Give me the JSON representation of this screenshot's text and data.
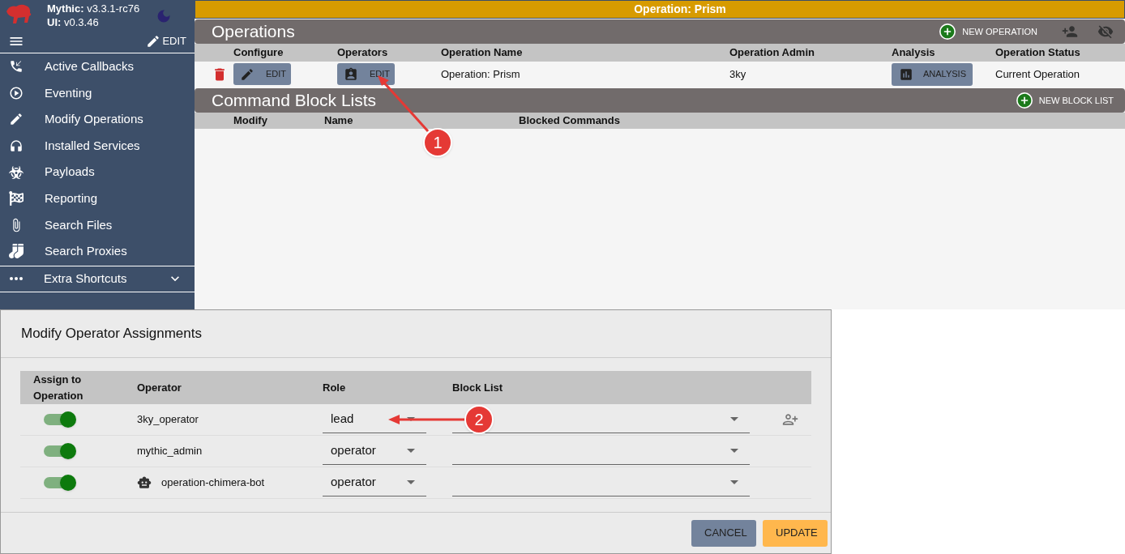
{
  "app": {
    "name_label": "Mythic:",
    "version": "v3.3.1-rc76",
    "ui_label": "UI:",
    "ui_version": "v0.3.46",
    "edit_label": "EDIT"
  },
  "sidebar": {
    "items": [
      {
        "label": "Active Callbacks"
      },
      {
        "label": "Eventing"
      },
      {
        "label": "Modify Operations"
      },
      {
        "label": "Installed Services"
      },
      {
        "label": "Payloads"
      },
      {
        "label": "Reporting"
      },
      {
        "label": "Search Files"
      },
      {
        "label": "Search Proxies"
      }
    ],
    "extra": {
      "label": "Extra Shortcuts",
      "expanded": false
    }
  },
  "banner": "Operation: Prism",
  "operations": {
    "title": "Operations",
    "new_button": "NEW OPERATION",
    "columns": [
      "Configure",
      "Operators",
      "Operation Name",
      "Operation Admin",
      "Analysis",
      "Operation Status"
    ],
    "rows": [
      {
        "configure": "EDIT",
        "operators": "EDIT",
        "name": "Operation: Prism",
        "admin": "3ky",
        "analysis": "ANALYSIS",
        "status": "Current Operation"
      }
    ]
  },
  "block_lists": {
    "title": "Command Block Lists",
    "new_button": "NEW BLOCK LIST",
    "columns": [
      "Modify",
      "Name",
      "Blocked Commands"
    ]
  },
  "dialog": {
    "title": "Modify Operator Assignments",
    "columns": [
      "Assign to Operation",
      "Operator",
      "Role",
      "Block List"
    ],
    "rows": [
      {
        "assigned": true,
        "kind": "human",
        "operator": "3ky_operator",
        "role": "lead",
        "add_user": true
      },
      {
        "assigned": true,
        "kind": "human",
        "operator": "mythic_admin",
        "role": "operator",
        "add_user": false
      },
      {
        "assigned": true,
        "kind": "bot",
        "operator": "operation-chimera-bot",
        "role": "operator",
        "add_user": false
      }
    ],
    "buttons": [
      "CANCEL",
      "UPDATE"
    ]
  },
  "annotations": [
    {
      "number": "1"
    },
    {
      "number": "2"
    }
  ]
}
